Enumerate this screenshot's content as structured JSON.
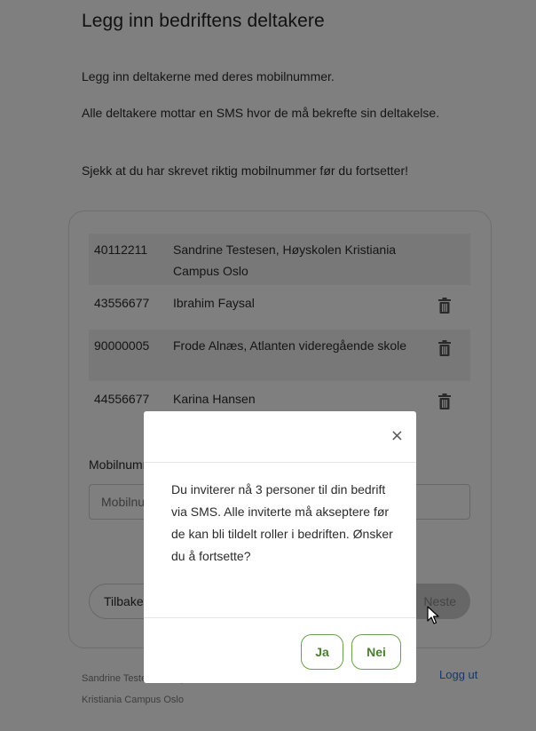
{
  "page": {
    "title": "Legg inn bedriftens deltakere",
    "paragraphs": [
      "Legg inn deltakerne med deres mobilnummer.",
      "Alle deltakere mottar en SMS hvor de må bekrefte sin deltakelse.",
      "Sjekk at du har skrevet riktig mobilnummer før du fortsetter!"
    ]
  },
  "participants": [
    {
      "number": "40112211",
      "name": "Sandrine Testesen, Høyskolen Kristiania Campus Oslo",
      "deletable": false
    },
    {
      "number": "43556677",
      "name": "Ibrahim Faysal",
      "deletable": true
    },
    {
      "number": "90000005",
      "name": "Frode Alnæs, Atlanten videregående skole",
      "deletable": true
    },
    {
      "number": "44556677",
      "name": "Karina Hansen",
      "deletable": true
    }
  ],
  "form": {
    "mobile_label": "Mobilnummer",
    "mobile_placeholder": "Mobilnummer",
    "back_label": "Tilbake",
    "next_label": "Neste"
  },
  "footer": {
    "user_name": "Sandrine Testesen, Høyskolen Kristiania Campus Oslo",
    "logout_label": "Logg ut"
  },
  "modal": {
    "close_label": "×",
    "message": "Du inviterer nå 3 personer til din bedrift via SMS. Alle inviterte må akseptere før de kan bli tildelt roller i bedriften. Ønsker du å fortsette?",
    "confirm_label": "Ja",
    "cancel_label": "Nei"
  },
  "colors": {
    "accent_green": "#4d7d33",
    "link_blue": "#2a6fd6",
    "overlay": "rgba(0,0,0,0.5)"
  }
}
